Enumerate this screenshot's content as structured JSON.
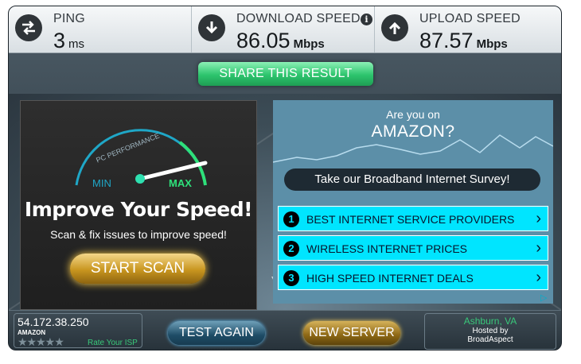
{
  "stats": {
    "ping": {
      "label": "PING",
      "value": "3",
      "unit": "ms"
    },
    "download": {
      "label": "DOWNLOAD SPEED",
      "value": "86.05",
      "unit": "Mbps"
    },
    "upload": {
      "label": "UPLOAD SPEED",
      "value": "87.57",
      "unit": "Mbps"
    }
  },
  "share_label": "SHARE THIS RESULT",
  "ad_left": {
    "gauge_label": "PC PERFORMANCE",
    "min_label": "MIN",
    "max_label": "MAX",
    "headline": "Improve Your Speed!",
    "subtitle": "Scan & fix issues to improve speed!",
    "button": "START SCAN"
  },
  "ad_right": {
    "question": "Are you on",
    "isp": "AMAZON?",
    "survey": "Take our Broadband Internet Survey!",
    "links": [
      {
        "num": "1",
        "text": "BEST INTERNET SERVICE PROVIDERS"
      },
      {
        "num": "2",
        "text": "WIRELESS INTERNET PRICES"
      },
      {
        "num": "3",
        "text": "HIGH SPEED INTERNET DEALS"
      }
    ]
  },
  "bottom": {
    "ip": "54.172.38.250",
    "isp": "AMAZON",
    "stars": "★★★★★",
    "rate": "Rate Your ISP",
    "test_again": "TEST AGAIN",
    "new_server": "NEW SERVER",
    "city": "Ashburn, VA",
    "hosted_by": "Hosted by",
    "host": "BroadAspect"
  },
  "colors": {
    "accent_green": "#2cc46d",
    "ad_cyan": "#00e5ff",
    "button_gold": "#c8951f"
  },
  "icons": [
    "ping-arrows-icon",
    "download-arrow-icon",
    "upload-arrow-icon",
    "info-icon",
    "gauge-icon",
    "chevron-right-icon",
    "adchoices-icon"
  ]
}
